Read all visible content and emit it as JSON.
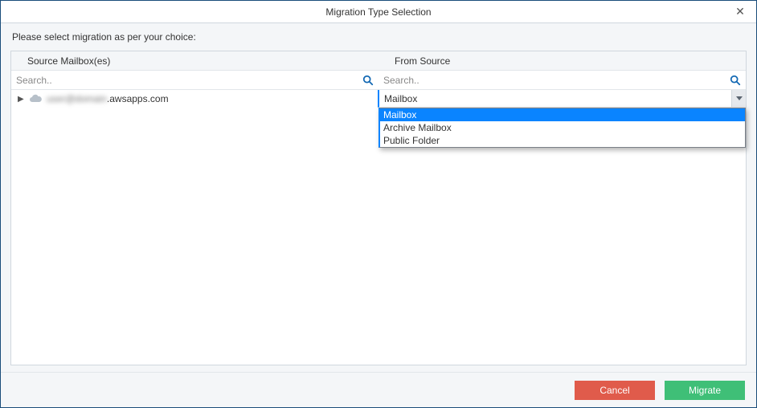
{
  "window": {
    "title": "Migration Type Selection",
    "close_glyph": "✕"
  },
  "instruction": "Please select migration as per your choice:",
  "columns": {
    "left_header": "Source Mailbox(es)",
    "right_header": "From Source"
  },
  "search": {
    "left_placeholder": "Search..",
    "right_placeholder": "Search.."
  },
  "tree": {
    "items": [
      {
        "obscured_prefix": "user@domain",
        "visible_suffix": ".awsapps.com"
      }
    ]
  },
  "combo": {
    "selected": "Mailbox",
    "options": [
      "Mailbox",
      "Archive Mailbox",
      "Public Folder"
    ]
  },
  "buttons": {
    "cancel": "Cancel",
    "migrate": "Migrate"
  }
}
